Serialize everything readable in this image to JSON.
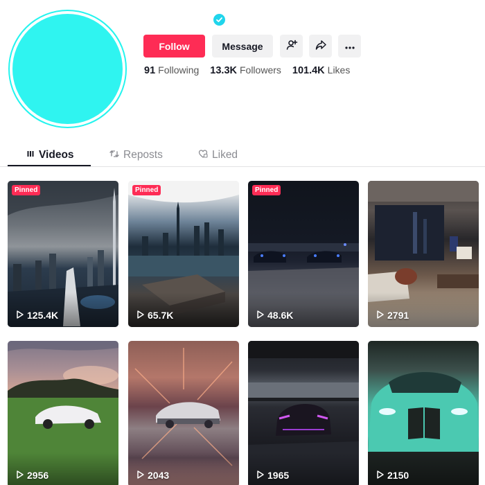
{
  "profile": {
    "follow_label": "Follow",
    "message_label": "Message",
    "stats": [
      {
        "value": "91",
        "label": "Following"
      },
      {
        "value": "13.3K",
        "label": "Followers"
      },
      {
        "value": "101.4K",
        "label": "Likes"
      }
    ]
  },
  "tabs": [
    {
      "label": "Videos",
      "active": true
    },
    {
      "label": "Reposts",
      "active": false
    },
    {
      "label": "Liked",
      "active": false
    }
  ],
  "videos": [
    {
      "pinned": "Pinned",
      "views": "125.4K"
    },
    {
      "pinned": "Pinned",
      "views": "65.7K"
    },
    {
      "pinned": "Pinned",
      "views": "48.6K"
    },
    {
      "pinned": "",
      "views": "2791"
    },
    {
      "pinned": "",
      "views": "2956"
    },
    {
      "pinned": "",
      "views": "2043"
    },
    {
      "pinned": "",
      "views": "1965"
    },
    {
      "pinned": "",
      "views": "2150"
    }
  ],
  "colors": {
    "accent": "#fe2c55",
    "verified": "#20d5ec",
    "avatar": "#2ff4f0"
  },
  "icons": [
    "verified-badge-icon",
    "add-user-icon",
    "share-icon",
    "more-icon",
    "videos-grid-icon",
    "repost-icon",
    "liked-icon",
    "play-icon"
  ]
}
